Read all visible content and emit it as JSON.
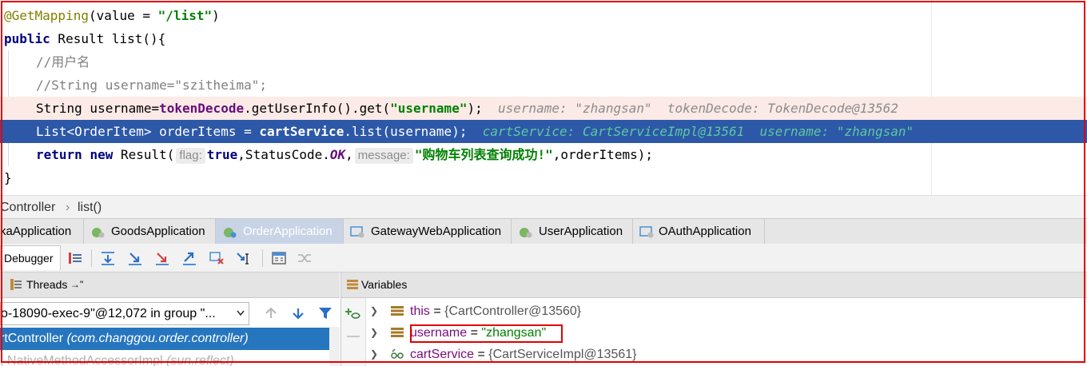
{
  "editor": {
    "line1": {
      "annotation": "@GetMapping",
      "open": "(value = ",
      "path": "\"/list\"",
      "close": ")"
    },
    "line2": {
      "kw": "public",
      "rest": " Result list(){"
    },
    "line3": {
      "comment": "//用户名"
    },
    "line4": {
      "comment": "//String username=\"szitheima\";"
    },
    "line5": {
      "pre": "String username=",
      "field": "tokenDecode",
      "mid": ".getUserInfo().get(",
      "str": "\"username\"",
      "post": ");",
      "inlay": "username: \"zhangsan\"  tokenDecode: TokenDecode@13562"
    },
    "line6": {
      "pre": "List<OrderItem> orderItems = ",
      "field": "cartService",
      "mid": ".list(username);",
      "inlay": "cartService: CartServiceImpl@13561  username: \"zhangsan\""
    },
    "line7": {
      "kw1": "return",
      "kw2": "new",
      "pre": " Result(",
      "hint1": "flag:",
      "val1": "true",
      "mid": ",StatusCode.",
      "const": "OK",
      "comma": ",",
      "hint2": "message:",
      "str": "\"购物车列表查询成功!\"",
      "post": ",orderItems);"
    },
    "line8": {
      "text": "}"
    }
  },
  "breadcrumb": {
    "cls": "Controller",
    "sep": "›",
    "method": "list()"
  },
  "run_tabs": [
    {
      "label": "kaApplication"
    },
    {
      "label": "GoodsApplication"
    },
    {
      "label": "OrderApplication"
    },
    {
      "label": "GatewayWebApplication"
    },
    {
      "label": "UserApplication"
    },
    {
      "label": "OAuthApplication"
    }
  ],
  "debugger": {
    "tab_label": "Debugger"
  },
  "threads": {
    "header": "Threads",
    "header_suffix": "→\"",
    "selected_thread": "o-18090-exec-9\"@12,072 in group \"...",
    "frames": [
      {
        "name": "rtController",
        "pkg": "(com.changgou.order.controller)"
      },
      {
        "name": ", NativeMethodAccessorImpl",
        "pkg": "(sun.reflect)"
      }
    ]
  },
  "variables": {
    "header": "Variables",
    "items": [
      {
        "name": "this",
        "eq": " = ",
        "value": "{CartController@13560}"
      },
      {
        "name": "username",
        "eq": " = ",
        "value": "\"zhangsan\""
      },
      {
        "name": "cartService",
        "eq": " = ",
        "value": "{CartServiceImpl@13561}"
      }
    ]
  },
  "colors": {
    "selection": "#2d58a8",
    "highlight": "#e00000",
    "warn_line": "#fbeae6"
  }
}
